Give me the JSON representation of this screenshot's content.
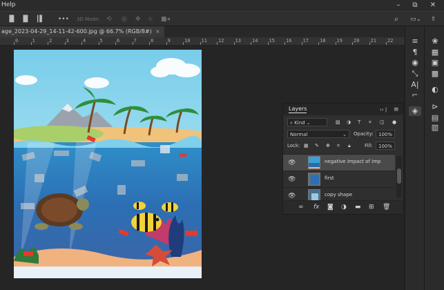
{
  "menubar": {
    "help_label": "Help"
  },
  "window_controls": {
    "minimize": "–",
    "restore": "⧉",
    "close": "✕"
  },
  "options_bar": {
    "more": "•••",
    "mode_3d": "3D Mode:"
  },
  "top_right": {
    "search_icon": "search-icon",
    "workspace_icon": "workspace-icon",
    "share_icon": "share-icon"
  },
  "document": {
    "tab_label": "age_2023-04-29_14-11-42-600.jpg @ 66.7% (RGB/8#)",
    "close_label": "×"
  },
  "ruler": {
    "labels": [
      "0",
      "1",
      "2",
      "3",
      "4",
      "5",
      "6",
      "7",
      "8",
      "9",
      "10",
      "11",
      "12",
      "13",
      "14",
      "15",
      "16",
      "17",
      "18",
      "19",
      "20",
      "21",
      "22"
    ]
  },
  "layers_panel": {
    "title": "Layers",
    "collapse": "›› |",
    "menu": "≡",
    "filter_kind": "Kind",
    "blend_mode": "Normal",
    "opacity_label": "Opacity:",
    "opacity_value": "100%",
    "lock_label": "Lock:",
    "fill_label": "Fill:",
    "fill_value": "100%",
    "layers": [
      {
        "name": "negative impact of imp",
        "selected": true
      },
      {
        "name": "first",
        "selected": false
      },
      {
        "name": "copy shape",
        "selected": false
      }
    ]
  },
  "colors": {
    "app_bg": "#1e1e1e",
    "panel": "#2f2f2f",
    "selected_layer": "#4a4a4a"
  }
}
